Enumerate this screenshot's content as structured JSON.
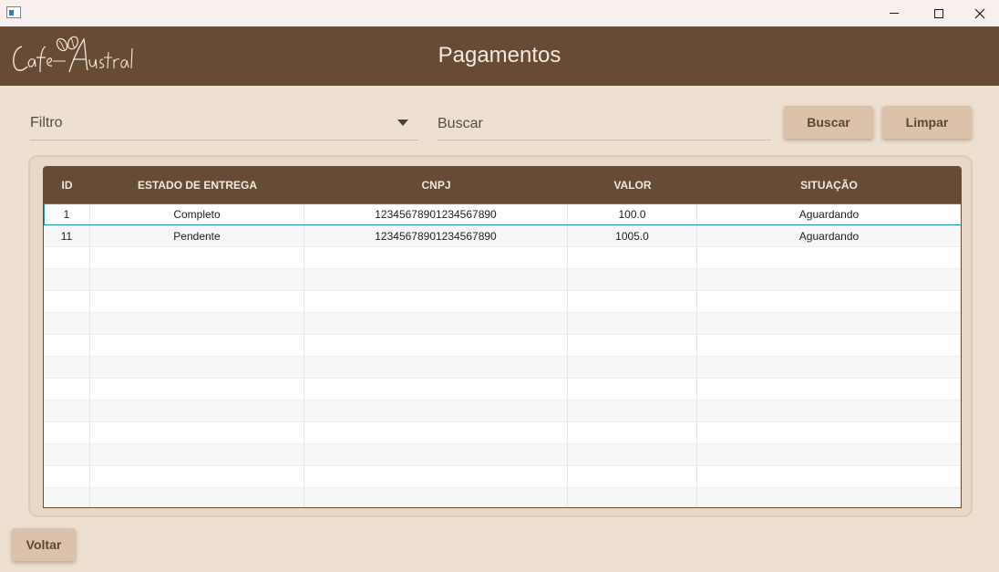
{
  "header": {
    "title": "Pagamentos",
    "logo_text": "Cafe Austral"
  },
  "toolbar": {
    "filter_label": "Filtro",
    "search_placeholder": "Buscar",
    "search_label": "Buscar",
    "clear_label": "Limpar"
  },
  "table": {
    "columns": [
      "ID",
      "ESTADO DE ENTREGA",
      "CNPJ",
      "VALOR",
      "SITUAÇÃO"
    ],
    "rows": [
      [
        "1",
        "Completo",
        "12345678901234567890",
        "100.0",
        "Aguardando"
      ],
      [
        "11",
        "Pendente",
        "12345678901234567890",
        "1005.0",
        "Aguardando"
      ]
    ],
    "selected_row": 0,
    "empty_rows": 12
  },
  "footer": {
    "back_label": "Voltar"
  },
  "colors": {
    "brand": "#674b34",
    "background": "#eee0d0",
    "button": "#dcc2aa",
    "selection": "#1e93a4"
  }
}
